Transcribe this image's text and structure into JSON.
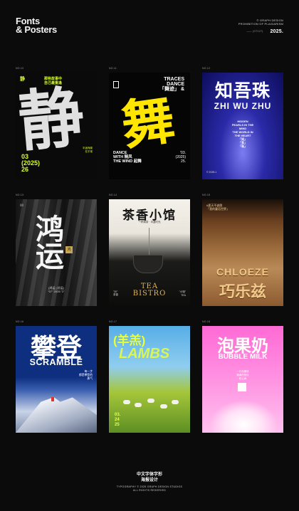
{
  "brand": {
    "line1": "Fonts",
    "line2": "& Posters"
  },
  "topright": {
    "line1": "© GRAPH DESIGN",
    "line2": "PROHIBITION OF PLAGIARISM",
    "small": "—— (GT127)",
    "year": "2025."
  },
  "posters": [
    {
      "no": "NO.10",
      "big": "静",
      "head": "静",
      "side": "那些故事中\n自己最重逢",
      "year": "03\n(2025)\n26",
      "foot": "半途而废\n在平常"
    },
    {
      "no": "NO.11",
      "trace": "TRACES\nDANCE\n「舞迹」 &",
      "big": "舞",
      "dance": "DANCE\nWITH 随风\nTHE WIND 起舞",
      "date": "'03.\n(2025)\n25."
    },
    {
      "no": "NO.12",
      "cn": "知吾珠",
      "en": "ZHI WU ZHU",
      "mid": "HIDDEN\nPEARLS IN THE\nMIND\nTHE WORLD IN\nTHE HEART\n「知」\n「吾」\n「珠」",
      "bot": "© 2025.1"
    },
    {
      "no": "NO.13",
      "big": "鸿\n运",
      "seal": "鸿",
      "foot": "(鸿运 | 好运)\n\"07\" 2025 \"2\"",
      "tl": "(|||)"
    },
    {
      "no": "NO.14",
      "t": "茶香小馆",
      "sub": "一杯清茶 · 半盏时光",
      "tea": "TEA\nBISTRO",
      "s1": "\"30\"\n茶香",
      "s2": "\"小馆\"\nTEA"
    },
    {
      "no": "NO.15",
      "hdr": "#夏天不逃脱\n「我的童话世界」",
      "en": "CHLOEZE",
      "cn": "巧乐兹"
    },
    {
      "no": "NO.16",
      "cn": "攀登",
      "en": "SCRAMBLE",
      "txt": "每一步\n都是攀登的\n勇气"
    },
    {
      "no": "NO.17",
      "cn": "(羊羔)",
      "en": "LAMBS",
      "date": "03.\n24\n25"
    },
    {
      "no": "NO.18",
      "cn": "泡果奶",
      "en": "BUBBLE MILK",
      "txt": "一口泡果奶\n满满的快乐\n在心间"
    }
  ],
  "footer": {
    "cn1": "中文字体字形",
    "cn2": "海报设计",
    "en1": "TYPOGRAPHY © 2025 GRAPH DESIGN STUDIOS",
    "en2": "ALL RIGHTS RESERVED"
  }
}
